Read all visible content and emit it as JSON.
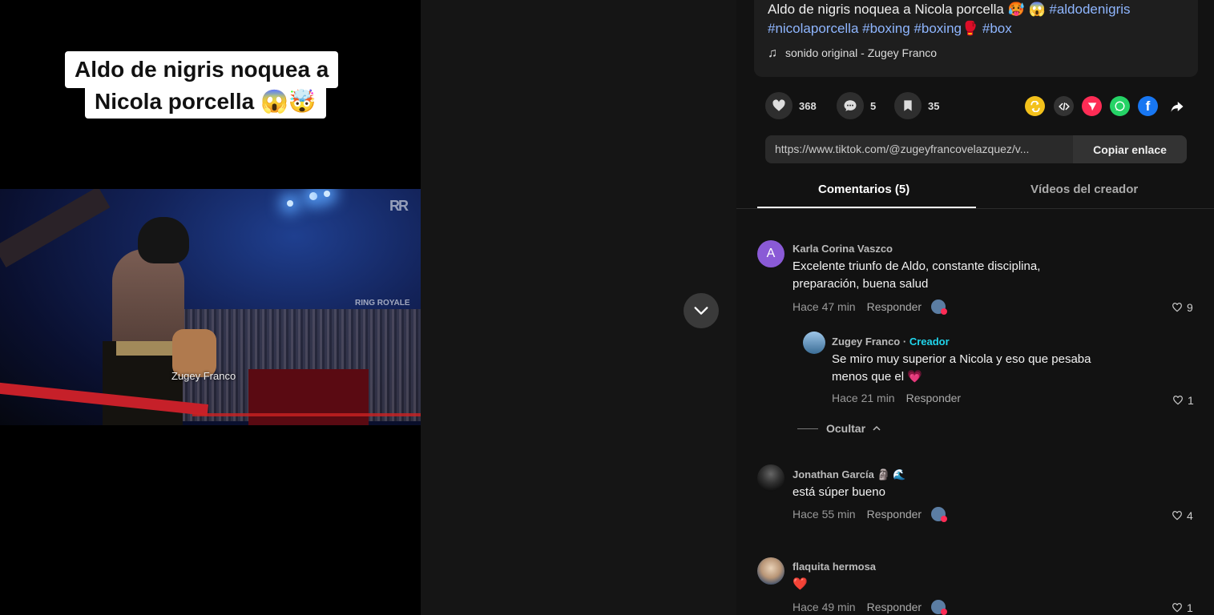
{
  "video": {
    "caption_line1": "Aldo de nigris noquea a",
    "caption_line2": "Nicola porcella 😱🤯",
    "creator_watermark": "Zugey Franco",
    "watermark_logo": "RR",
    "watermark_ring": "RING ROYALE"
  },
  "post": {
    "desc_prefix": "Aldo de nigris noquea a Nicola porcella 🥵 😱",
    "hashtags": [
      "#aldodenigris",
      "#nicolaporcella",
      "#boxing",
      "#boxing🥊",
      "#box"
    ],
    "sound": "sonido original - Zugey Franco"
  },
  "stats": {
    "likes": "368",
    "comments": "5",
    "saves": "35"
  },
  "share": {
    "link": "https://www.tiktok.com/@zugeyfrancovelazquez/v...",
    "copy_label": "Copiar enlace"
  },
  "tabs": {
    "comments": "Comentarios (5)",
    "creator_videos": "Vídeos del creador"
  },
  "comments": [
    {
      "avatar_letter": "A",
      "username": "Karla Corina Vaszco",
      "text": "Excelente triunfo de Aldo, constante disciplina, preparación, buena salud",
      "time": "Hace 47 min",
      "reply": "Responder",
      "likes": "9"
    },
    {
      "username": "Zugey Franco",
      "creator_label": "Creador",
      "text": "Se miro muy superior a Nicola y eso que pesaba menos que el 💗",
      "time": "Hace 21 min",
      "reply": "Responder",
      "likes": "1"
    },
    {
      "username": "Jonathan García 🗿 🌊",
      "text": "está súper bueno",
      "time": "Hace 55 min",
      "reply": "Responder",
      "likes": "4"
    },
    {
      "username": "flaquita hermosa",
      "text": "❤️",
      "time": "Hace 49 min",
      "reply": "Responder",
      "likes": "1"
    }
  ],
  "hide_label": "Ocultar"
}
